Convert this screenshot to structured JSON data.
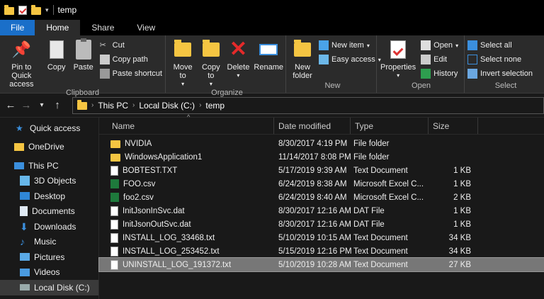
{
  "window": {
    "title": "temp"
  },
  "tabs": [
    {
      "label": "File"
    },
    {
      "label": "Home"
    },
    {
      "label": "Share"
    },
    {
      "label": "View"
    }
  ],
  "ribbon": {
    "clipboard": {
      "label": "Clipboard",
      "pin": "Pin to Quick access",
      "copy": "Copy",
      "paste": "Paste",
      "cut": "Cut",
      "copy_path": "Copy path",
      "paste_shortcut": "Paste shortcut"
    },
    "organize": {
      "label": "Organize",
      "move_to": "Move to",
      "copy_to": "Copy to",
      "delete": "Delete",
      "rename": "Rename"
    },
    "new": {
      "label": "New",
      "new_folder": "New folder",
      "new_item": "New item",
      "easy_access": "Easy access"
    },
    "open": {
      "label": "Open",
      "properties": "Properties",
      "open": "Open",
      "edit": "Edit",
      "history": "History"
    },
    "select": {
      "label": "Select",
      "select_all": "Select all",
      "select_none": "Select none",
      "invert": "Invert selection"
    }
  },
  "address": {
    "crumbs": [
      "This PC",
      "Local Disk (C:)",
      "temp"
    ]
  },
  "sidebar": {
    "items": [
      {
        "label": "Quick access",
        "icon": "star-icon"
      },
      {
        "label": "OneDrive",
        "icon": "folder-icon"
      },
      {
        "label": "This PC",
        "icon": "computer-icon"
      },
      {
        "label": "3D Objects",
        "icon": "cube-icon"
      },
      {
        "label": "Desktop",
        "icon": "desktop-icon"
      },
      {
        "label": "Documents",
        "icon": "documents-icon"
      },
      {
        "label": "Downloads",
        "icon": "download-icon"
      },
      {
        "label": "Music",
        "icon": "music-icon"
      },
      {
        "label": "Pictures",
        "icon": "pictures-icon"
      },
      {
        "label": "Videos",
        "icon": "videos-icon"
      },
      {
        "label": "Local Disk (C:)",
        "icon": "drive-icon"
      }
    ]
  },
  "columns": [
    "Name",
    "Date modified",
    "Type",
    "Size"
  ],
  "files": [
    {
      "name": "NVIDIA",
      "date": "8/30/2017 4:19 PM",
      "type": "File folder",
      "size": "",
      "kind": "folder"
    },
    {
      "name": "WindowsApplication1",
      "date": "11/14/2017 8:08 PM",
      "type": "File folder",
      "size": "",
      "kind": "folder"
    },
    {
      "name": "BOBTEST.TXT",
      "date": "5/17/2019 9:39 AM",
      "type": "Text Document",
      "size": "1 KB",
      "kind": "doc"
    },
    {
      "name": "FOO.csv",
      "date": "6/24/2019 8:38 AM",
      "type": "Microsoft Excel C...",
      "size": "1 KB",
      "kind": "xls"
    },
    {
      "name": "foo2.csv",
      "date": "6/24/2019 8:40 AM",
      "type": "Microsoft Excel C...",
      "size": "2 KB",
      "kind": "xls"
    },
    {
      "name": "InitJsonInSvc.dat",
      "date": "8/30/2017 12:16 AM",
      "type": "DAT File",
      "size": "1 KB",
      "kind": "doc"
    },
    {
      "name": "InitJsonOutSvc.dat",
      "date": "8/30/2017 12:16 AM",
      "type": "DAT File",
      "size": "1 KB",
      "kind": "doc"
    },
    {
      "name": "INSTALL_LOG_33468.txt",
      "date": "5/10/2019 10:15 AM",
      "type": "Text Document",
      "size": "34 KB",
      "kind": "doc"
    },
    {
      "name": "INSTALL_LOG_253452.txt",
      "date": "5/15/2019 12:16 PM",
      "type": "Text Document",
      "size": "34 KB",
      "kind": "doc"
    },
    {
      "name": "UNINSTALL_LOG_191372.txt",
      "date": "5/10/2019 10:28 AM",
      "type": "Text Document",
      "size": "27 KB",
      "kind": "doc",
      "selected": true
    }
  ]
}
